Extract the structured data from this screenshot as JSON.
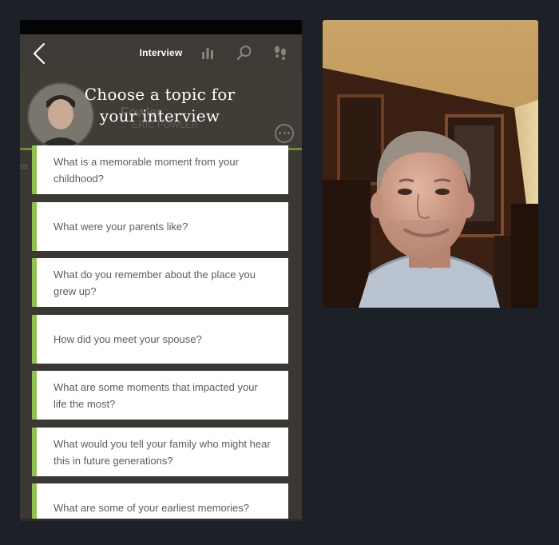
{
  "nav": {
    "title": "Interview",
    "back_icon": "chevron-left-icon",
    "icons": [
      "bar-chart-icon",
      "search-icon",
      "footsteps-icon"
    ]
  },
  "profile": {
    "ghost_name": "Fowler",
    "ghost_sub": "ERIC FOWLER"
  },
  "heading": {
    "line1": "Choose a topic for",
    "line2": "your interview"
  },
  "topics": [
    "What is a memorable moment from your childhood?",
    "What were your parents like?",
    "What do you remember about the place you grew up?",
    "How did you meet your spouse?",
    "What are some moments that impacted your life the most?",
    "What would you tell your family who might hear this in future generations?",
    "What are some of your earliest memories?"
  ],
  "colors": {
    "accent": "#8dc63f",
    "background": "#1b2126",
    "panel": "#3b3833"
  }
}
